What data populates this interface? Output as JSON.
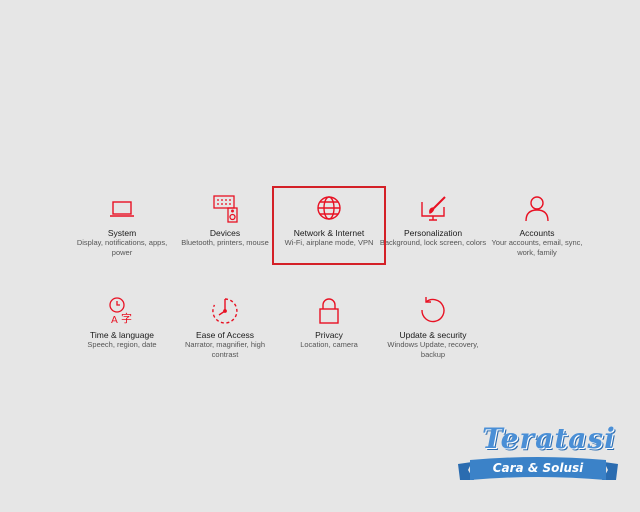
{
  "accent_color": "#e81123",
  "selection_color": "#d42027",
  "selected_tile": "network-internet",
  "tiles": [
    {
      "id": "system",
      "icon": "laptop-icon",
      "title": "System",
      "desc": "Display, notifications, apps, power"
    },
    {
      "id": "devices",
      "icon": "keyboard-speaker-icon",
      "title": "Devices",
      "desc": "Bluetooth, printers, mouse"
    },
    {
      "id": "network",
      "icon": "globe-icon",
      "title": "Network & Internet",
      "desc": "Wi-Fi, airplane mode, VPN"
    },
    {
      "id": "personalization",
      "icon": "paintbrush-monitor-icon",
      "title": "Personalization",
      "desc": "Background, lock screen, colors"
    },
    {
      "id": "accounts",
      "icon": "person-icon",
      "title": "Accounts",
      "desc": "Your accounts, email, sync, work, family"
    },
    {
      "id": "time",
      "icon": "clock-language-icon",
      "title": "Time & language",
      "desc": "Speech, region, date"
    },
    {
      "id": "ease",
      "icon": "ease-of-access-icon",
      "title": "Ease of Access",
      "desc": "Narrator, magnifier, high contrast"
    },
    {
      "id": "privacy",
      "icon": "lock-icon",
      "title": "Privacy",
      "desc": "Location, camera"
    },
    {
      "id": "update",
      "icon": "refresh-icon",
      "title": "Update & security",
      "desc": "Windows Update, recovery, backup"
    }
  ],
  "watermark": {
    "brand": "Teratasi",
    "tagline": "Cara & Solusi",
    "brand_color": "#4a8fd6",
    "ribbon_color": "#3b82c8"
  }
}
